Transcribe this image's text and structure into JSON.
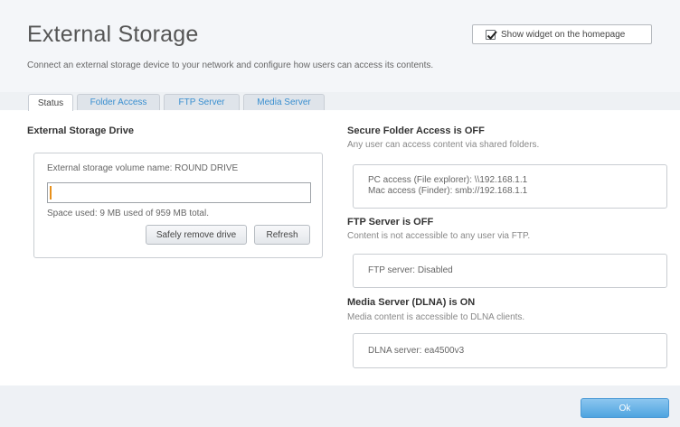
{
  "corner_mark": "E",
  "header": {
    "title": "External Storage",
    "subtitle": "Connect an external storage device to your network and configure how users can access its contents.",
    "widget_label": "Show widget on the homepage",
    "widget_checked": true
  },
  "tabs": [
    {
      "label": "Status",
      "active": true
    },
    {
      "label": "Folder Access",
      "active": false
    },
    {
      "label": "FTP Server",
      "active": false
    },
    {
      "label": "Media Server",
      "active": false
    }
  ],
  "drive": {
    "title": "External Storage Drive",
    "volume_label": "External storage volume name: ROUND DRIVE",
    "volume_value": "",
    "space_used": "Space used: 9 MB used of 959 MB total.",
    "remove_button": "Safely remove drive",
    "refresh_button": "Refresh"
  },
  "secure": {
    "title": "Secure Folder Access is OFF",
    "desc": "Any user can access content via shared folders.",
    "pc_access": "PC access (File explorer): \\\\192.168.1.1",
    "mac_access": "Mac access (Finder): smb://192.168.1.1"
  },
  "ftp": {
    "title": "FTP Server is OFF",
    "desc": "Content is not accessible to any user via FTP.",
    "status": "FTP server: Disabled"
  },
  "media": {
    "title": "Media Server (DLNA) is ON",
    "desc": "Media content is accessible to DLNA clients.",
    "status": "DLNA server: ea4500v3"
  },
  "footer": {
    "ok_label": "Ok"
  },
  "colors": {
    "accent": "#3a8fd0",
    "ok_button": "#4ea4e0",
    "caret": "#e8901a"
  }
}
